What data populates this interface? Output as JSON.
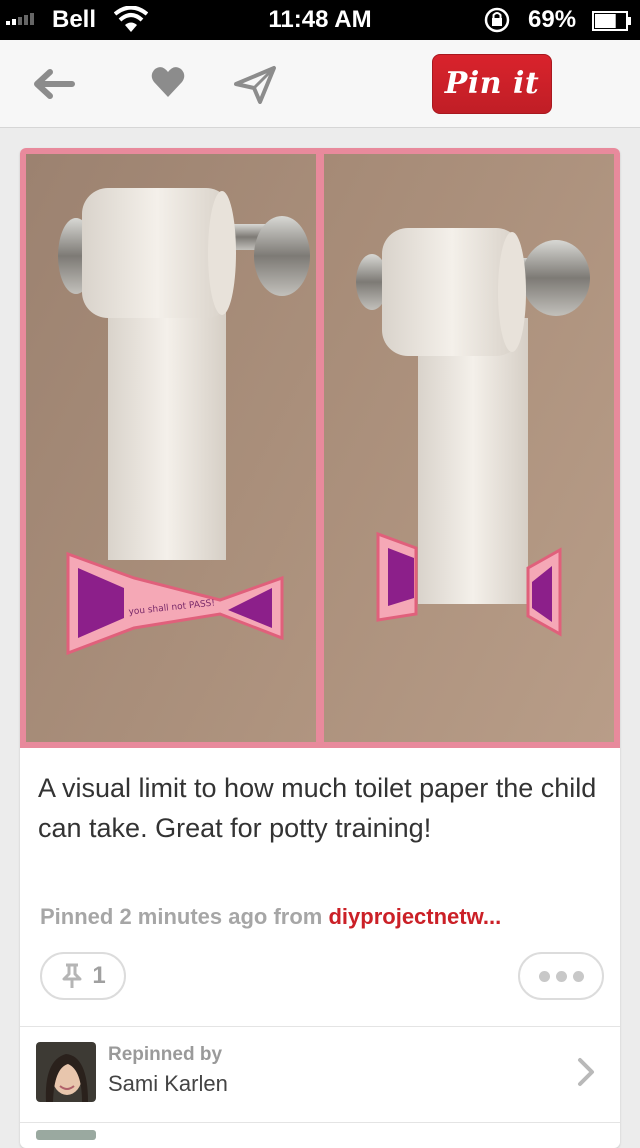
{
  "status_bar": {
    "carrier": "Bell",
    "time": "11:48 AM",
    "battery_percent": "69%",
    "battery_level": 0.69,
    "icons": [
      "signal-icon",
      "wifi-icon",
      "rotation-lock-icon",
      "battery-icon"
    ]
  },
  "navbar": {
    "icons": [
      "back-arrow-icon",
      "heart-icon",
      "send-icon"
    ],
    "pin_it_label": "Pin it",
    "brand_color": "#cb2027"
  },
  "pin": {
    "image_text": "you shall not PASS!",
    "description": "A visual limit to how much toilet paper the child can take. Great for potty training!",
    "pinned_prefix": "Pinned 2 minutes ago from ",
    "source": "diyprojectnetw...",
    "repin_count": "1",
    "repin_icon": "pin-icon",
    "more_icon": "more-dots-icon"
  },
  "repinned": {
    "label": "Repinned by",
    "name": "Sami Karlen",
    "chevron_icon": "chevron-right-icon"
  }
}
